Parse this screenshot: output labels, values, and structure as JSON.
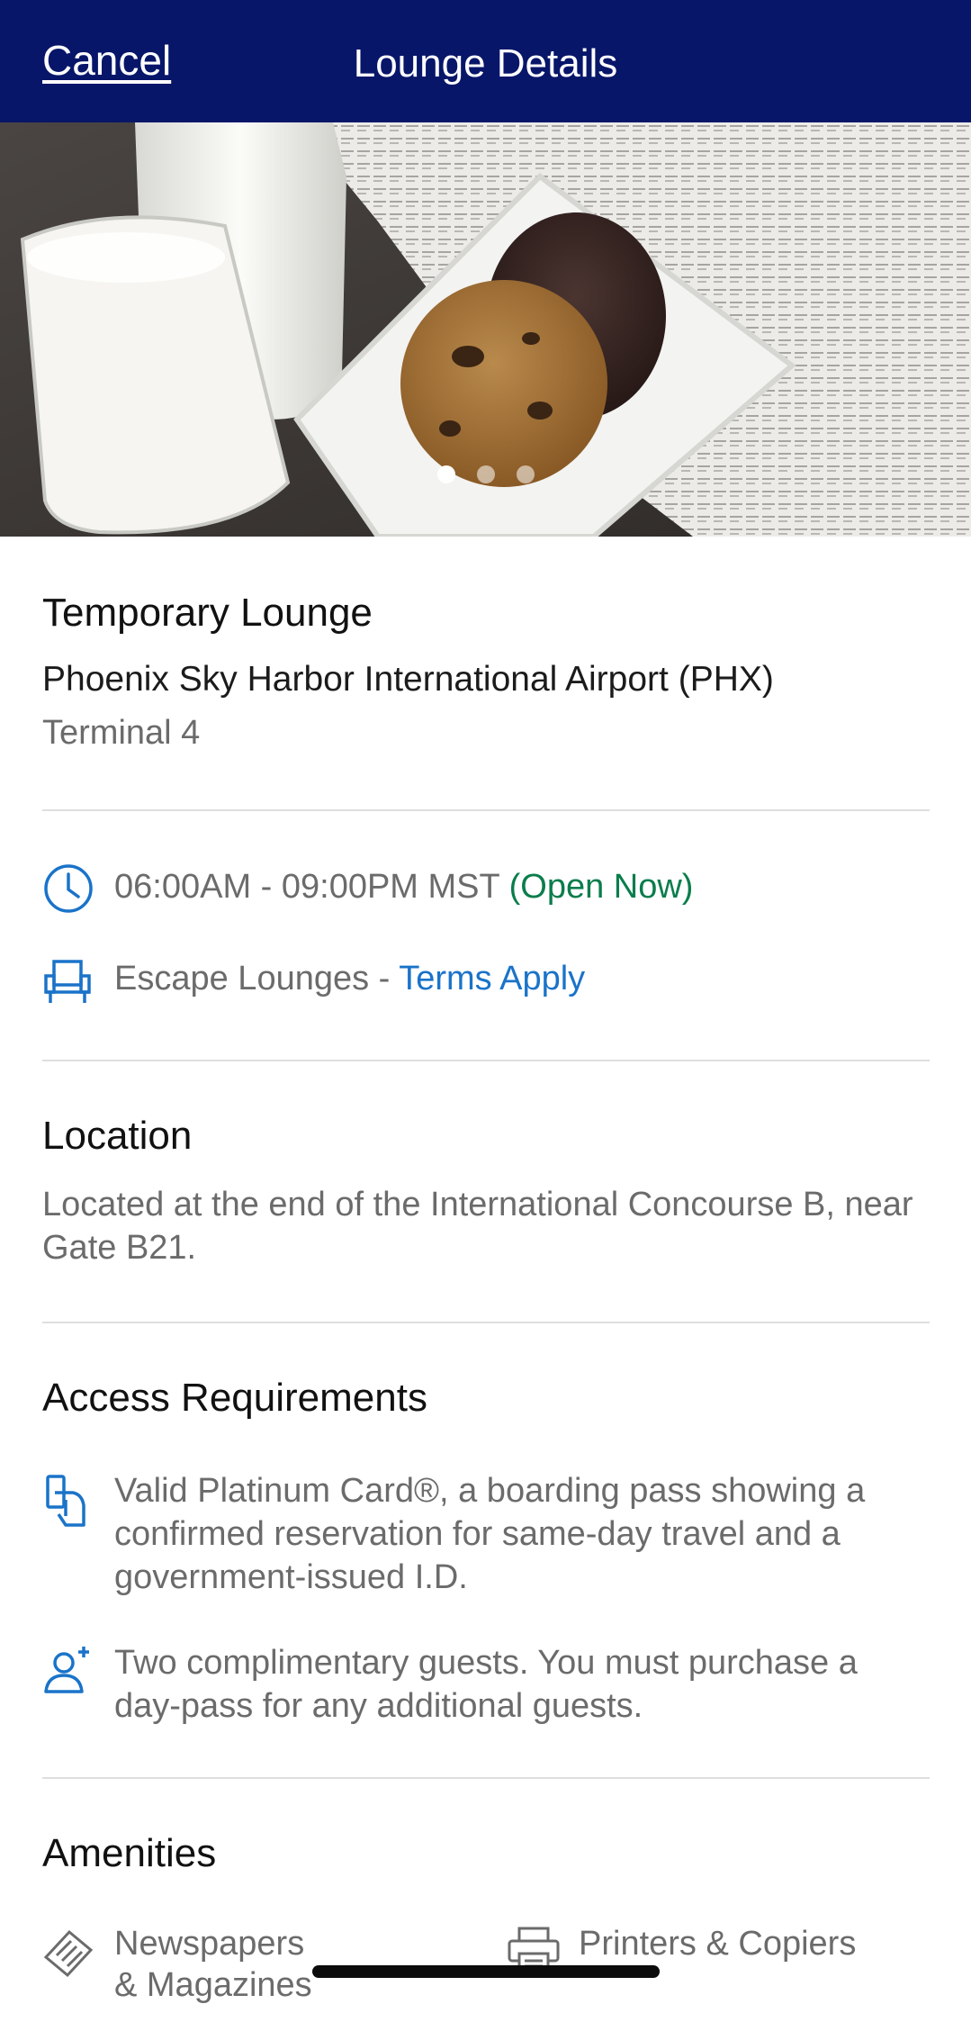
{
  "header": {
    "cancel_label": "Cancel",
    "title": "Lounge Details"
  },
  "carousel": {
    "image_alt_icon": "lounge-photo-cookies-milk",
    "page_count": 3,
    "active_index": 0
  },
  "lounge": {
    "name": "Temporary Lounge",
    "airport": "Phoenix Sky Harbor International Airport (PHX)",
    "terminal": "Terminal 4"
  },
  "hours": {
    "icon": "clock-icon",
    "time_range": "06:00AM - 09:00PM MST",
    "status": "(Open Now)",
    "status_color": "#0a7d4c"
  },
  "network": {
    "icon": "lounge-chair-icon",
    "name": "Escape Lounges - ",
    "terms_link": "Terms Apply",
    "link_color": "#1a73c9"
  },
  "location": {
    "title": "Location",
    "description": "Located at the end of the International Concourse B, near Gate B21."
  },
  "access": {
    "title": "Access Requirements",
    "items": [
      {
        "icon": "card-in-hand-icon",
        "text": "Valid Platinum Card®, a boarding pass showing a confirmed reservation for same-day travel and a government-issued I.D."
      },
      {
        "icon": "add-guest-icon",
        "text": "Two complimentary guests. You must purchase a day-pass for any additional guests."
      }
    ]
  },
  "amenities": {
    "title": "Amenities",
    "items": [
      {
        "icon": "newspaper-icon",
        "line1": "Newspapers",
        "line2": "& Magazines"
      },
      {
        "icon": "printer-icon",
        "line1": "Printers & Copiers"
      }
    ]
  },
  "colors": {
    "header_bg": "#071669",
    "accent_blue": "#1a73c9",
    "open_green": "#0a7d4c",
    "muted_text": "#6b6b6b"
  }
}
